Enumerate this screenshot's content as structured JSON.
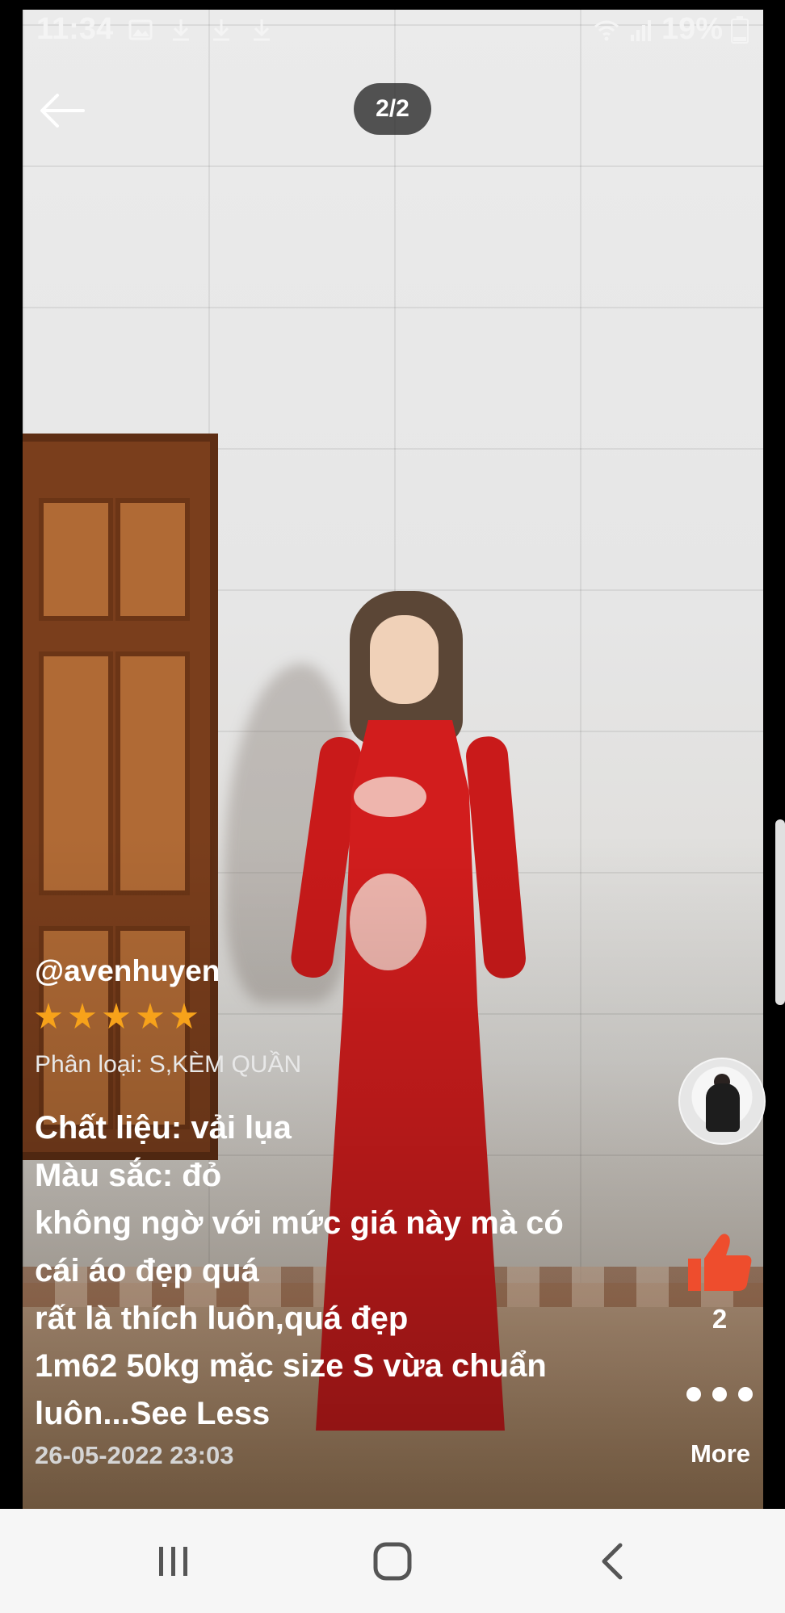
{
  "status_bar": {
    "time": "11:34",
    "battery": "19%"
  },
  "viewer": {
    "counter": "2/2"
  },
  "review": {
    "username": "@avenhuyen",
    "rating": 5,
    "variant": "Phân loại: S,KÈM QUẦN",
    "lines": [
      "Chất liệu: vải lụa",
      "Màu sắc: đỏ",
      "không ngờ với mức giá này mà có",
      "cái áo đẹp quá",
      "rất là thích luôn,quá đẹp",
      "1m62 50kg mặc size S vừa chuẩn",
      "luôn...See Less"
    ],
    "date": "26-05-2022 23:03"
  },
  "actions": {
    "like_count": "2",
    "more_label": "More"
  },
  "colors": {
    "accent": "#ee4d2d",
    "star": "#f7a21a"
  }
}
